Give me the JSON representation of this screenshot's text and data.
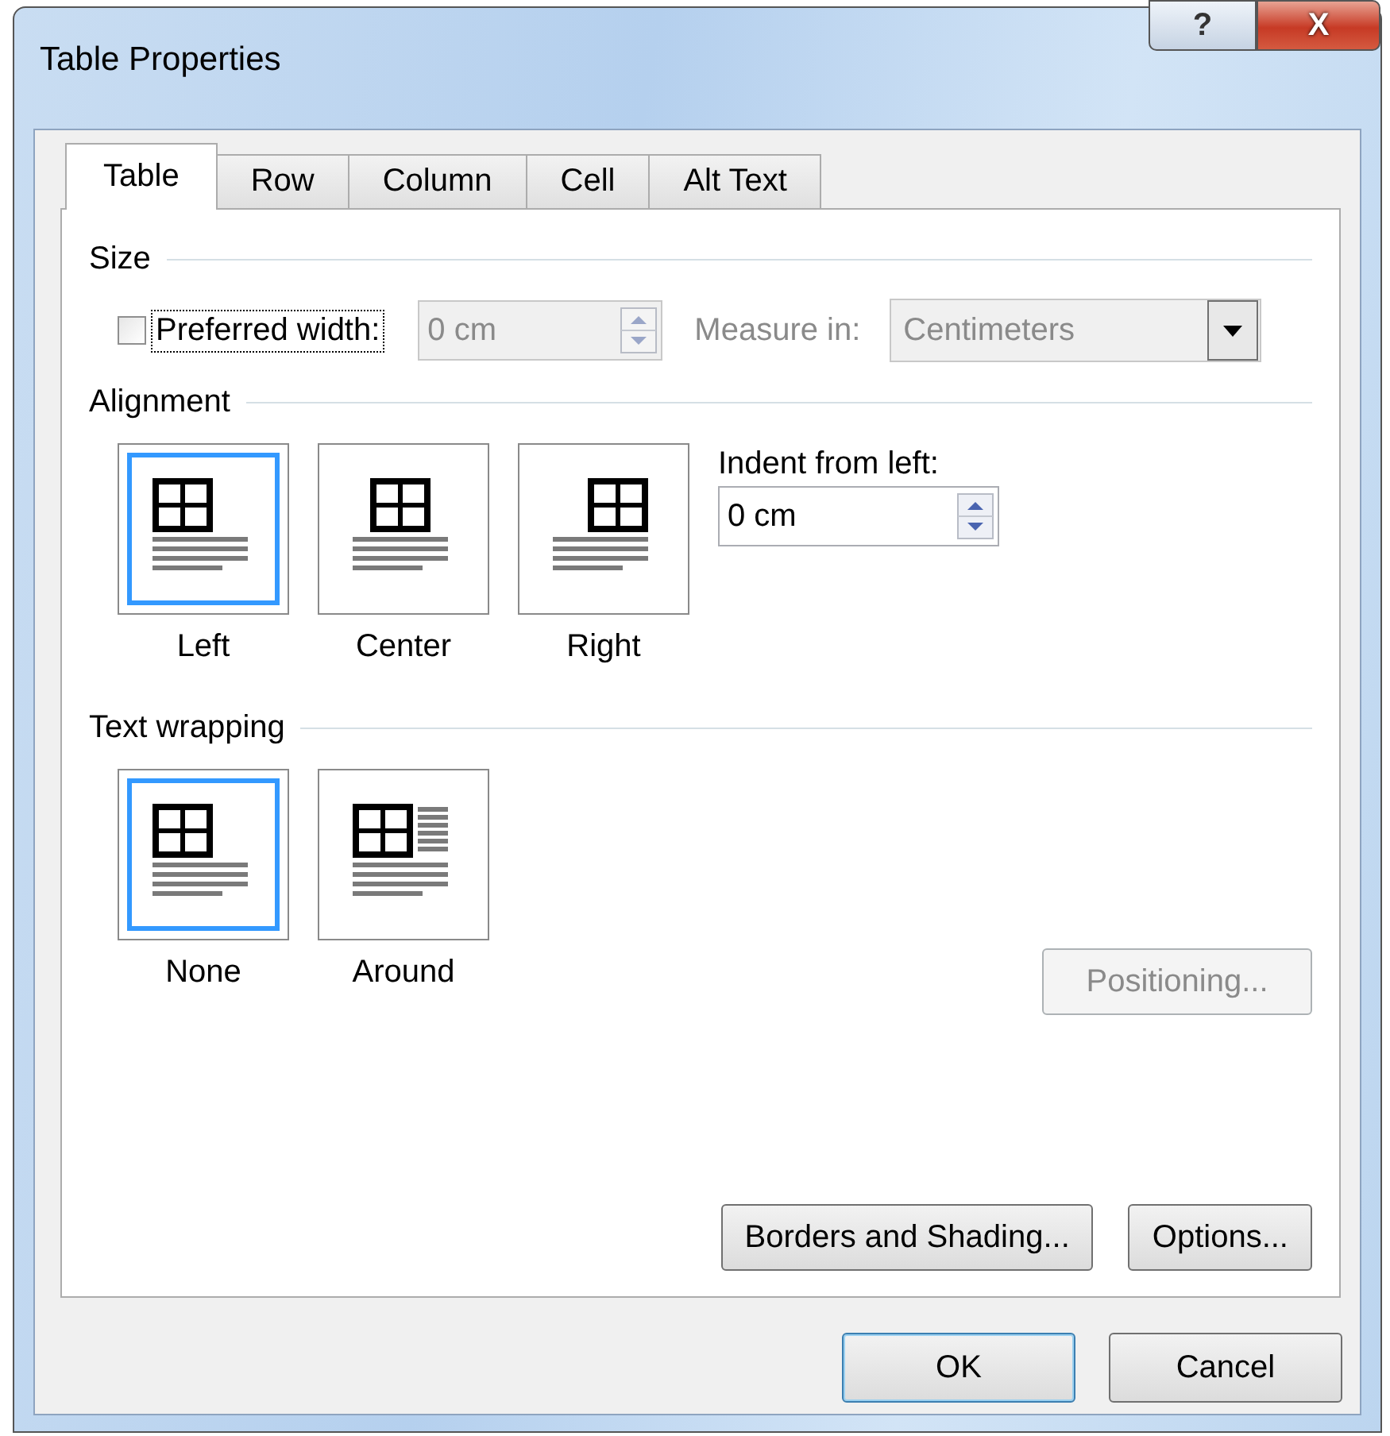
{
  "window": {
    "title": "Table Properties",
    "help": "?",
    "close": "X"
  },
  "tabs": [
    {
      "label": "Table",
      "selected": true
    },
    {
      "label": "Row",
      "selected": false
    },
    {
      "label": "Column",
      "selected": false
    },
    {
      "label": "Cell",
      "selected": false
    },
    {
      "label": "Alt Text",
      "selected": false
    }
  ],
  "size": {
    "heading": "Size",
    "preferred_width": {
      "label": "Preferred width:",
      "checked": false
    },
    "width_field": {
      "value": "0 cm",
      "disabled": true
    },
    "measure_in": {
      "label": "Measure in:",
      "value": "Centimeters",
      "disabled": true
    }
  },
  "alignment": {
    "heading": "Alignment",
    "options": [
      {
        "kind": "left",
        "label": "Left",
        "selected": true
      },
      {
        "kind": "center",
        "label": "Center",
        "selected": false
      },
      {
        "kind": "right",
        "label": "Right",
        "selected": false
      }
    ],
    "indent": {
      "label": "Indent from left:",
      "value": "0 cm"
    }
  },
  "text_wrapping": {
    "heading": "Text wrapping",
    "options": [
      {
        "kind": "none",
        "label": "None",
        "selected": true
      },
      {
        "kind": "around",
        "label": "Around",
        "selected": false
      }
    ],
    "positioning": {
      "label": "Positioning...",
      "disabled": true
    }
  },
  "buttons": [
    {
      "label": "Borders and Shading..."
    },
    {
      "label": "Options..."
    }
  ],
  "footer": [
    {
      "label": "OK",
      "default": true
    },
    {
      "label": "Cancel",
      "default": false
    }
  ]
}
